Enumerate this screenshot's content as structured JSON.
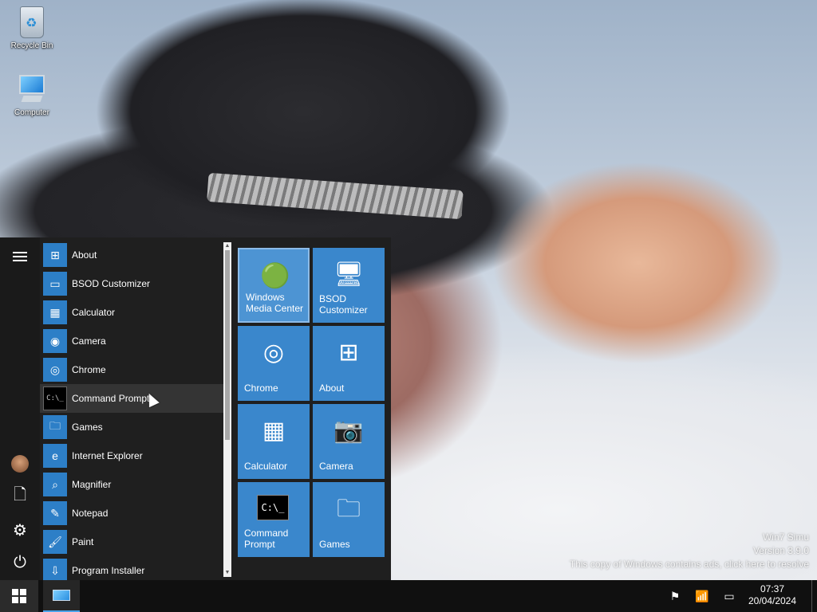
{
  "desktop": {
    "icons": [
      {
        "label": "Recycle Bin",
        "icon": "recycle-bin-icon"
      },
      {
        "label": "Computer",
        "icon": "computer-icon"
      }
    ],
    "watermark": {
      "line1": "Win7 Simu",
      "line2": "Version 3.9.0",
      "line3": "This copy of Windows contains ads, click here to resolve"
    }
  },
  "start_menu": {
    "rail": [
      {
        "icon": "hamburger-menu-icon"
      },
      {
        "icon": "user-avatar-icon"
      },
      {
        "icon": "document-icon"
      },
      {
        "icon": "gear-icon"
      },
      {
        "icon": "power-icon"
      }
    ],
    "apps": [
      {
        "label": "About",
        "icon": "windows-logo-icon"
      },
      {
        "label": "BSOD Customizer",
        "icon": "monitor-icon"
      },
      {
        "label": "Calculator",
        "icon": "calculator-icon"
      },
      {
        "label": "Camera",
        "icon": "camera-icon"
      },
      {
        "label": "Chrome",
        "icon": "chrome-icon"
      },
      {
        "label": "Command Prompt",
        "icon": "command-prompt-icon"
      },
      {
        "label": "Games",
        "icon": "games-folder-icon"
      },
      {
        "label": "Internet Explorer",
        "icon": "internet-explorer-icon"
      },
      {
        "label": "Magnifier",
        "icon": "magnifier-icon"
      },
      {
        "label": "Notepad",
        "icon": "notepad-icon"
      },
      {
        "label": "Paint",
        "icon": "paint-icon"
      },
      {
        "label": "Program Installer",
        "icon": "installer-icon"
      }
    ],
    "hovered_app": "Command Prompt",
    "tiles": [
      {
        "label_line1": "Windows",
        "label_line2": "Media Center",
        "icon": "windows-media-center-icon"
      },
      {
        "label_line1": "BSOD",
        "label_line2": "Customizer",
        "icon": "monitor-icon"
      },
      {
        "label_line1": "Chrome",
        "label_line2": "",
        "icon": "chrome-icon"
      },
      {
        "label_line1": "About",
        "label_line2": "",
        "icon": "windows-logo-icon"
      },
      {
        "label_line1": "Calculator",
        "label_line2": "",
        "icon": "calculator-icon"
      },
      {
        "label_line1": "Camera",
        "label_line2": "",
        "icon": "camera-icon"
      },
      {
        "label_line1": "Command",
        "label_line2": "Prompt",
        "icon": "command-prompt-icon"
      },
      {
        "label_line1": "Games",
        "label_line2": "",
        "icon": "games-folder-icon"
      }
    ]
  },
  "taskbar": {
    "start_icon": "windows-start-icon",
    "pinned_app_icon": "computer-icon",
    "tray": [
      {
        "icon": "flag-icon"
      },
      {
        "icon": "wifi-icon"
      },
      {
        "icon": "battery-icon"
      }
    ],
    "time": "07:37",
    "date": "20/04/2024"
  },
  "colors": {
    "tile": "#3a87cc",
    "menu_bg": "#1f1f1f",
    "taskbar_bg": "#101010",
    "accent": "#4aa3ea"
  }
}
